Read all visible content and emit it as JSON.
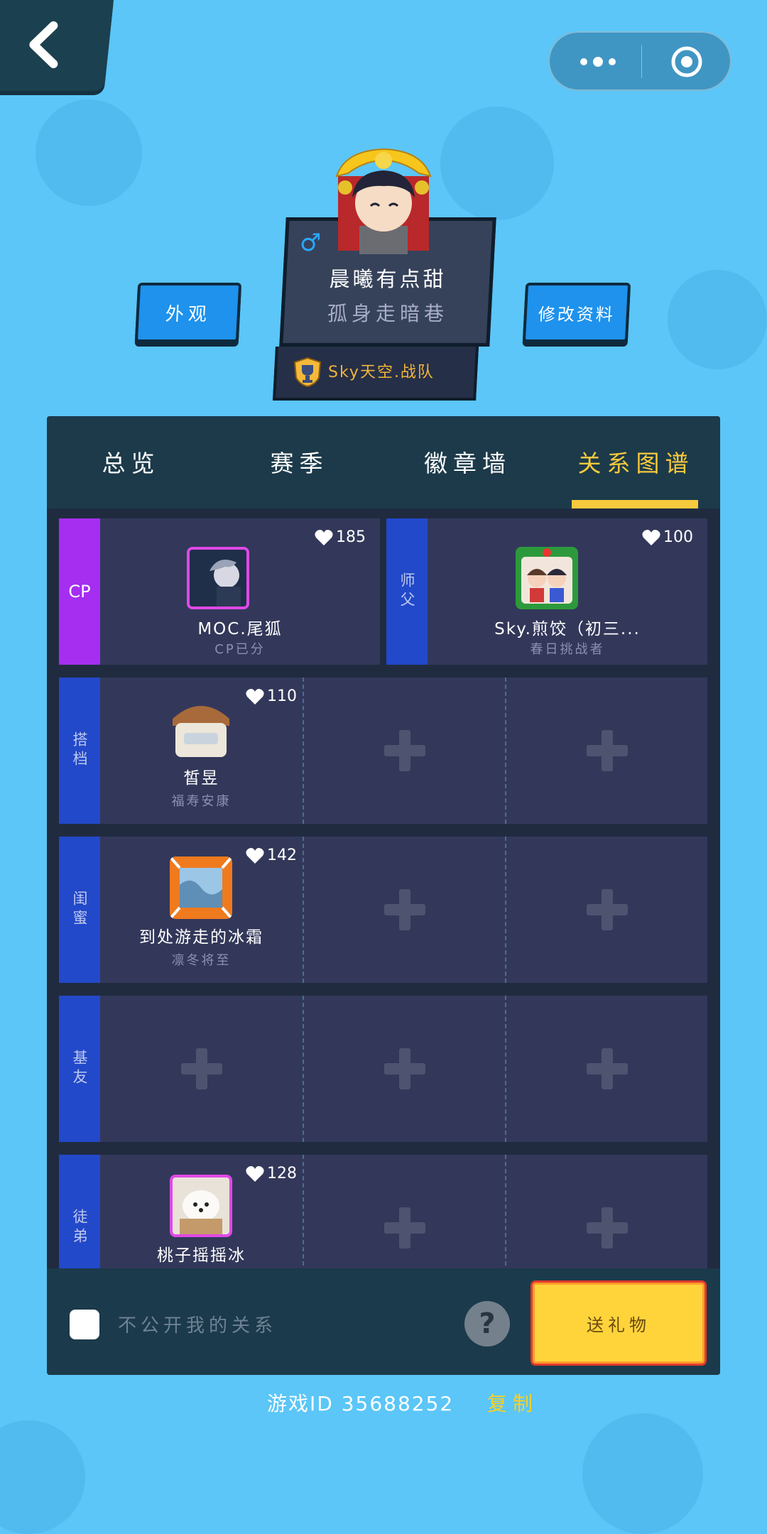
{
  "header": {
    "back_icon": "chevron-left-icon",
    "menu_icon": "more-dots-icon",
    "target_icon": "target-circle-icon"
  },
  "profile": {
    "appearance_button": "外观",
    "edit_profile_button": "修改资料",
    "gender_symbol": "♂",
    "nickname": "晨曦有点甜",
    "signature": "孤身走暗巷",
    "team": "Sky天空.战队"
  },
  "tabs": [
    {
      "label": "总览",
      "active": false
    },
    {
      "label": "赛季",
      "active": false
    },
    {
      "label": "徽章墙",
      "active": false
    },
    {
      "label": "关系图谱",
      "active": true
    }
  ],
  "relations": {
    "cp": {
      "category": "CP",
      "members": [
        {
          "name": "MOC.尾狐",
          "title": "CP已分",
          "hearts": "185",
          "frame_color": "#e048e6"
        }
      ]
    },
    "master": {
      "category": "师父",
      "members": [
        {
          "name": "Sky.煎饺（初三...",
          "title": "春日挑战者",
          "hearts": "100"
        }
      ]
    },
    "partner": {
      "category": "搭档",
      "members": [
        {
          "name": "皙昱",
          "title": "福寿安康",
          "hearts": "110"
        }
      ]
    },
    "bestie": {
      "category": "闺蜜",
      "members": [
        {
          "name": "到处游走的冰霜",
          "title": "凛冬将至",
          "hearts": "142"
        }
      ]
    },
    "buddy": {
      "category": "基友",
      "members": []
    },
    "apprentice": {
      "category": "徒弟",
      "members": [
        {
          "name": "桃子摇摇冰",
          "hearts": "128",
          "frame_color": "#e048e6"
        }
      ]
    }
  },
  "footer": {
    "private_label": "不公开我的关系",
    "help_symbol": "?",
    "gift_button": "送礼物"
  },
  "game_id": {
    "text": "游戏ID 35688252",
    "copy_label": "复制"
  },
  "colors": {
    "background": "#5bc6f7",
    "accent_yellow": "#f7c93c",
    "cp_purple": "#a52ef0",
    "category_blue": "#2249c9"
  }
}
